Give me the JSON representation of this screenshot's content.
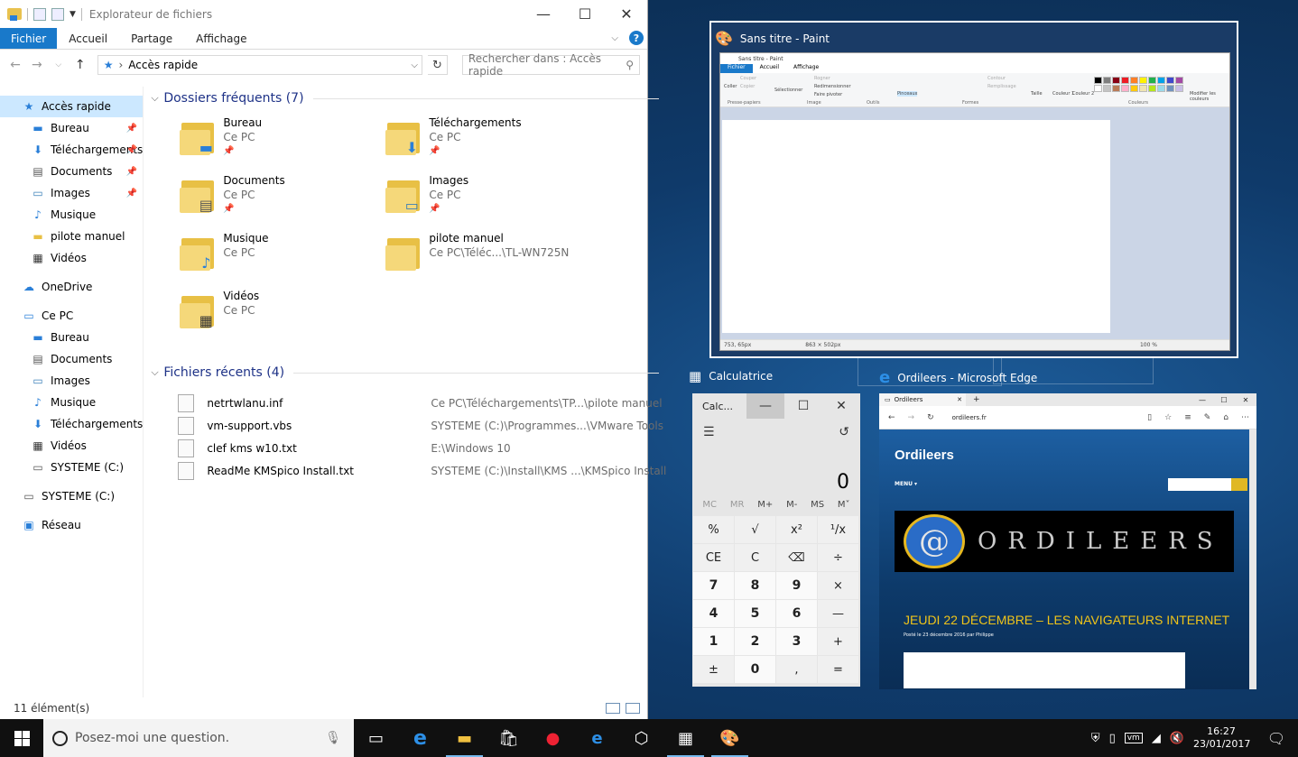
{
  "explorer": {
    "title": "Explorateur de fichiers",
    "ribbon_tabs": [
      "Fichier",
      "Accueil",
      "Partage",
      "Affichage"
    ],
    "address": "Accès rapide",
    "search_placeholder": "Rechercher dans : Accès rapide",
    "nav": [
      {
        "label": "Accès rapide",
        "icon": "star-icon",
        "level": 0,
        "selected": true
      },
      {
        "label": "Bureau",
        "icon": "desktop-icon",
        "level": 1,
        "pinned": true
      },
      {
        "label": "Téléchargements",
        "icon": "download-icon",
        "level": 1,
        "pinned": true
      },
      {
        "label": "Documents",
        "icon": "document-icon",
        "level": 1,
        "pinned": true
      },
      {
        "label": "Images",
        "icon": "image-icon",
        "level": 1,
        "pinned": true
      },
      {
        "label": "Musique",
        "icon": "music-icon",
        "level": 1
      },
      {
        "label": "pilote manuel",
        "icon": "folder-icon",
        "level": 1
      },
      {
        "label": "Vidéos",
        "icon": "video-icon",
        "level": 1
      },
      {
        "label": "OneDrive",
        "icon": "cloud-icon",
        "level": 0
      },
      {
        "label": "Ce PC",
        "icon": "computer-icon",
        "level": 0
      },
      {
        "label": "Bureau",
        "icon": "desktop-icon",
        "level": 1
      },
      {
        "label": "Documents",
        "icon": "document-icon",
        "level": 1
      },
      {
        "label": "Images",
        "icon": "image-icon",
        "level": 1
      },
      {
        "label": "Musique",
        "icon": "music-icon",
        "level": 1
      },
      {
        "label": "Téléchargements",
        "icon": "download-icon",
        "level": 1
      },
      {
        "label": "Vidéos",
        "icon": "video-icon",
        "level": 1
      },
      {
        "label": "SYSTEME (C:)",
        "icon": "drive-icon",
        "level": 1
      },
      {
        "label": "SYSTEME (C:)",
        "icon": "drive-icon",
        "level": 0
      },
      {
        "label": "Réseau",
        "icon": "network-icon",
        "level": 0
      }
    ],
    "frequent_header": "Dossiers fréquents (7)",
    "frequent": [
      {
        "name": "Bureau",
        "location": "Ce PC",
        "pinned": true,
        "emblem": "desktop-icon"
      },
      {
        "name": "Téléchargements",
        "location": "Ce PC",
        "pinned": true,
        "emblem": "download-icon"
      },
      {
        "name": "Documents",
        "location": "Ce PC",
        "pinned": true,
        "emblem": "document-icon"
      },
      {
        "name": "Images",
        "location": "Ce PC",
        "pinned": true,
        "emblem": "image-icon"
      },
      {
        "name": "Musique",
        "location": "Ce PC",
        "pinned": false,
        "emblem": "music-icon"
      },
      {
        "name": "pilote manuel",
        "location": "Ce PC\\Téléc...\\TL-WN725N",
        "pinned": false,
        "emblem": ""
      },
      {
        "name": "Vidéos",
        "location": "Ce PC",
        "pinned": false,
        "emblem": "video-icon"
      }
    ],
    "recent_header": "Fichiers récents (4)",
    "recent": [
      {
        "name": "netrtwlanu.inf",
        "path": "Ce PC\\Téléchargements\\TP...\\pilote manuel"
      },
      {
        "name": "vm-support.vbs",
        "path": "SYSTEME (C:)\\Programmes...\\VMware Tools"
      },
      {
        "name": "clef kms w10.txt",
        "path": "E:\\Windows 10"
      },
      {
        "name": "ReadMe KMSpico Install.txt",
        "path": "SYSTEME (C:)\\Install\\KMS ...\\KMSpico Install"
      }
    ],
    "status": "11 élément(s)"
  },
  "paint": {
    "title": "Sans titre - Paint",
    "inner_title": "Sans titre - Paint",
    "tabs": [
      "Fichier",
      "Accueil",
      "Affichage"
    ],
    "groups": [
      "Presse-papiers",
      "Image",
      "Outils",
      "Formes",
      "Couleurs"
    ],
    "ribbon_items": {
      "paste": "Coller",
      "cut": "Couper",
      "copy": "Copier",
      "select": "Sélectionner",
      "crop": "Rogner",
      "resize": "Redimensionner",
      "rotate": "Faire pivoter",
      "brushes": "Pinceaux",
      "outline": "Contour",
      "fill": "Remplissage",
      "size": "Taille",
      "color1": "Couleur 1",
      "color2": "Couleur 2",
      "edit_colors": "Modifier les couleurs"
    },
    "status_pos": "753, 65px",
    "status_size": "863 × 502px",
    "zoom": "100 %",
    "palette": [
      "#000000",
      "#7f7f7f",
      "#880015",
      "#ed1c24",
      "#ff7f27",
      "#fff200",
      "#22b14c",
      "#00a2e8",
      "#3f48cc",
      "#a349a4",
      "#ffffff",
      "#c3c3c3",
      "#b97a57",
      "#ffaec9",
      "#ffc90e",
      "#efe4b0",
      "#b5e61d",
      "#99d9ea",
      "#7092be",
      "#c8bfe7"
    ]
  },
  "calculator": {
    "label": "Calculatrice",
    "title": "Calc...",
    "display": "0",
    "memory": [
      "MC",
      "MR",
      "M+",
      "M-",
      "MS",
      "M˅"
    ],
    "keys": [
      "%",
      "√",
      "x²",
      "¹/x",
      "CE",
      "C",
      "⌫",
      "÷",
      "7",
      "8",
      "9",
      "×",
      "4",
      "5",
      "6",
      "—",
      "1",
      "2",
      "3",
      "+",
      "±",
      "0",
      ",",
      "="
    ]
  },
  "edge": {
    "label": "Ordileers - Microsoft Edge",
    "tab_title": "Ordileers",
    "url": "ordileers.fr",
    "site_title": "Ordileers",
    "menu": "MENU",
    "banner_text": "ORDILEERS",
    "logo_text": "@",
    "post_title": "JEUDI 22 DÉCEMBRE – LES NAVIGATEURS INTERNET",
    "post_meta": "Posté le 23 décembre 2016 par Philippe"
  },
  "taskbar": {
    "search_placeholder": "Posez-moi une question.",
    "apps": [
      "task-view-icon",
      "edge-icon",
      "explorer-icon",
      "store-icon",
      "app-red-icon",
      "ie-icon",
      "app-icon",
      "calculator-icon",
      "paint-icon"
    ],
    "time": "16:27",
    "date": "23/01/2017"
  }
}
